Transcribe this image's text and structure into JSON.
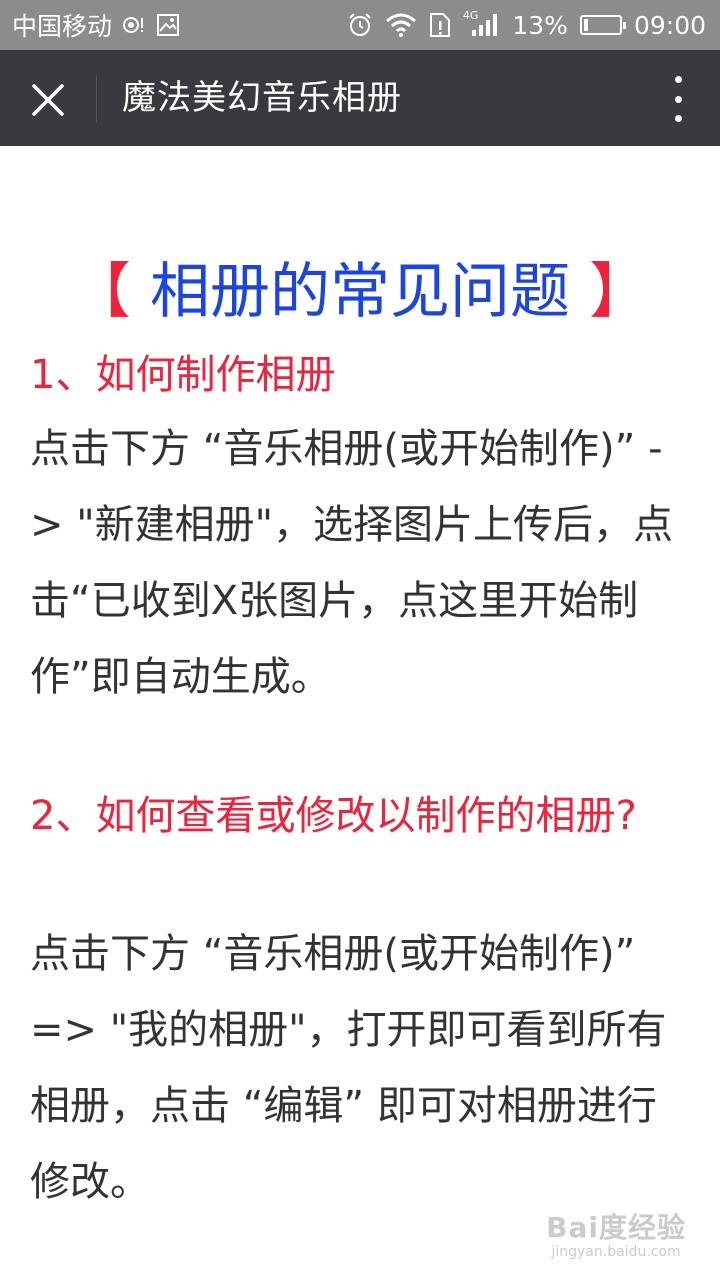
{
  "status_bar": {
    "carrier": "中国移动",
    "network_badge": "4G",
    "battery_percent": "13%",
    "battery_level": 0.13,
    "time": "09:00"
  },
  "nav": {
    "title": "魔法美幻音乐相册"
  },
  "article": {
    "heading_open": "【",
    "heading_text": " 相册的常见问题 ",
    "heading_close": "】",
    "q1": "1、如何制作相册",
    "a1": "点击下方 “音乐相册(或开始制作)” -> \"新建相册\"，选择图片上传后，点击“已收到X张图片，点这里开始制作”即自动生成。",
    "q2": "2、如何查看或修改以制作的相册?",
    "a2": "点击下方 “音乐相册(或开始制作)” => \"我的相册\"，打开即可看到所有相册，点击 “编辑” 即可对相册进行修改。"
  },
  "watermark": {
    "brand": "Bai度经验",
    "sub": "jingyan.baidu.com"
  },
  "colors": {
    "nav_bg": "#393a3f",
    "status_bg": "#8c8c8c",
    "red": "#f0213b",
    "blue": "#1a44e6",
    "body_text": "#333333"
  }
}
